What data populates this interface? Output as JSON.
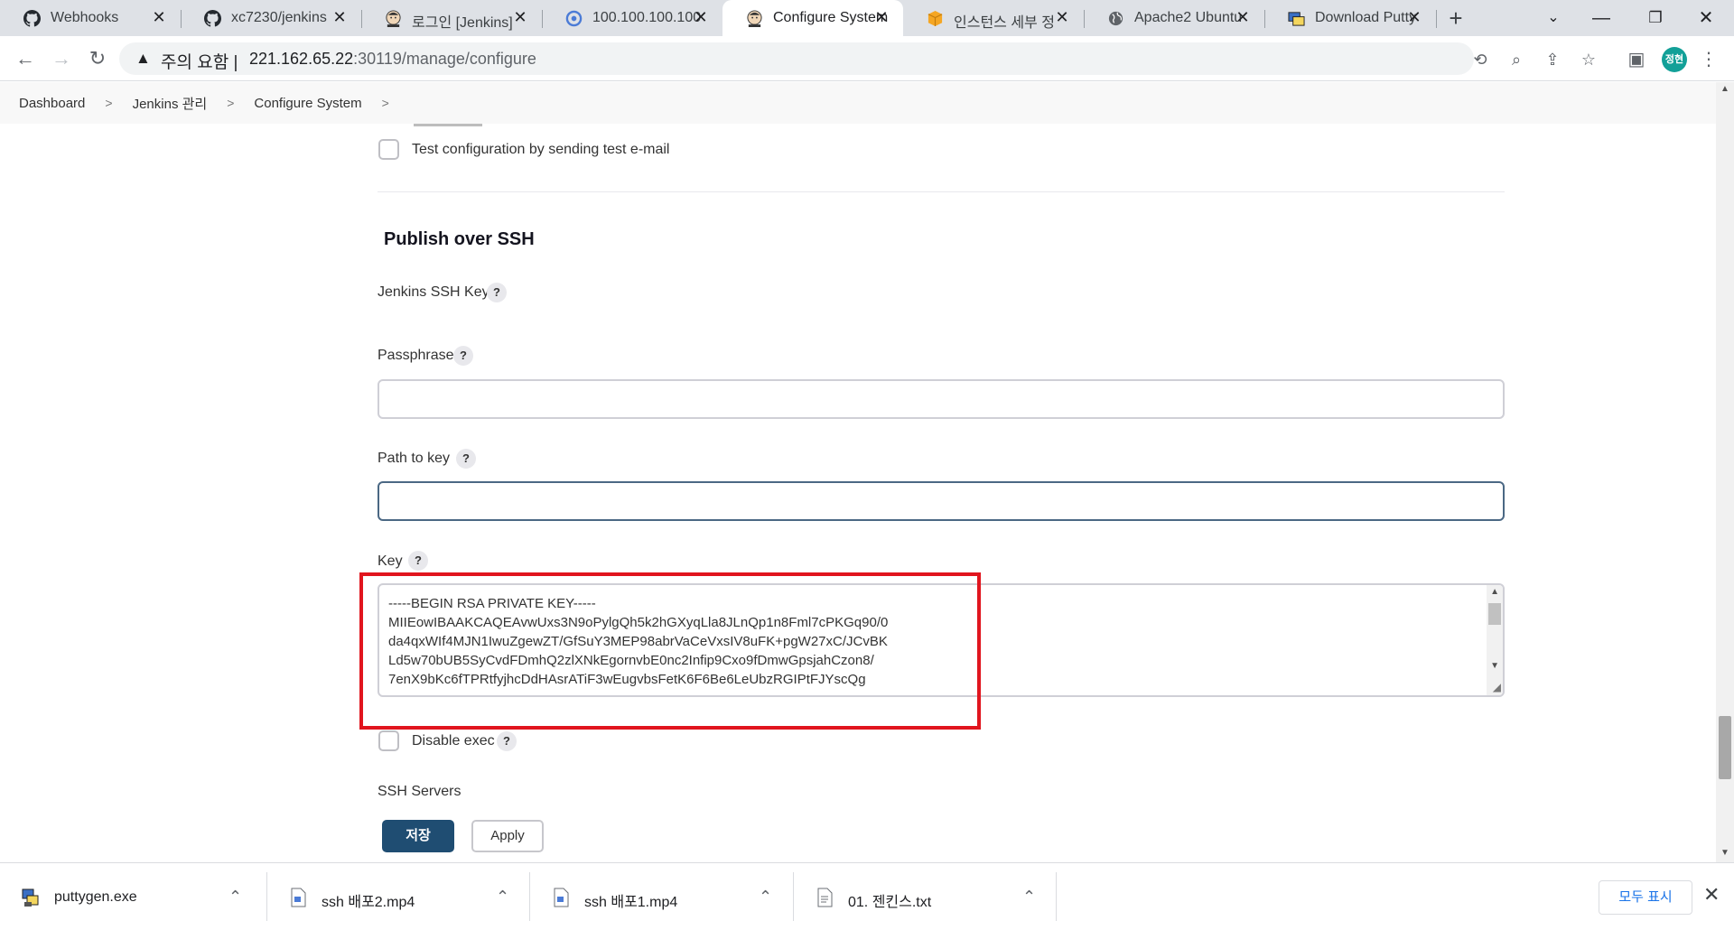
{
  "tabs": [
    {
      "title": "Webhooks",
      "icon": "github-icon"
    },
    {
      "title": "xc7230/jenkins",
      "icon": "github-icon"
    },
    {
      "title": "로그인 [Jenkins]",
      "icon": "jenkins-icon"
    },
    {
      "title": "100.100.100.100",
      "icon": "loading-icon"
    },
    {
      "title": "Configure System",
      "icon": "jenkins-icon",
      "active": true
    },
    {
      "title": "인스턴스 세부 정",
      "icon": "aws-box-icon"
    },
    {
      "title": "Apache2 Ubuntu",
      "icon": "globe-icon"
    },
    {
      "title": "Download Putty",
      "icon": "putty-icon"
    }
  ],
  "omnibox": {
    "security_label": "주의 요함",
    "separator": "|",
    "host": "221.162.65.22",
    "path": ":30119/manage/configure"
  },
  "profile": {
    "initials": "정현",
    "color": "#12a098"
  },
  "breadcrumb": [
    "Dashboard",
    "Jenkins 관리",
    "Configure System"
  ],
  "breadcrumb_sep": ">",
  "form": {
    "test_email_label": "Test configuration by sending test e-mail",
    "section_title": "Publish over SSH",
    "jenkins_ssh_key_label": "Jenkins SSH Key",
    "passphrase_label": "Passphrase",
    "passphrase_value": "",
    "path_to_key_label": "Path to key",
    "path_to_key_value": "",
    "key_label": "Key",
    "key_value": "-----BEGIN RSA PRIVATE KEY-----\nMIIEowIBAAKCAQEAvwUxs3N9oPylgQh5k2hGXyqLla8JLnQp1n8Fml7cPKGq90/0\nda4qxWIf4MJN1IwuZgewZT/GfSuY3MEP98abrVaCeVxsIV8uFK+pgW27xC/JCvBK\nLd5w70bUB5SyCvdFDmhQ2zlXNkEgornvbE0nc2Infip9Cxo9fDmwGpsjahCzon8/\n7enX9bKc6fTPRtfyjhcDdHAsrATiF3wEugvbsFetK6F6Be6LeUbzRGIPtFJYscQg",
    "disable_exec_label": "Disable exec",
    "ssh_servers_label": "SSH Servers",
    "help_glyph": "?"
  },
  "buttons": {
    "save": "저장",
    "apply": "Apply"
  },
  "downloads": [
    {
      "name": "puttygen.exe",
      "icon": "puttygen-icon"
    },
    {
      "name": "ssh 배포2.mp4",
      "icon": "video-file-icon"
    },
    {
      "name": "ssh 배포1.mp4",
      "icon": "video-file-icon"
    },
    {
      "name": "01. 젠킨스.txt",
      "icon": "text-file-icon"
    }
  ],
  "show_all_label": "모두 표시",
  "colors": {
    "save_button": "#1f4d72",
    "highlight": "#e1151e",
    "link": "#1a73e8"
  }
}
